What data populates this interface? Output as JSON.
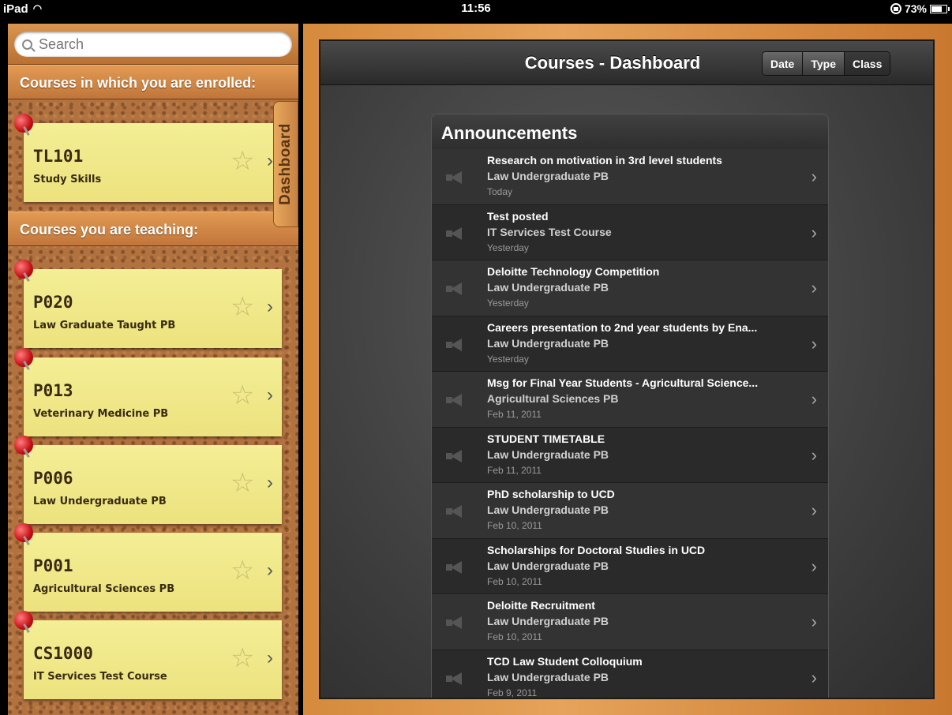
{
  "status": {
    "device": "iPad",
    "time": "11:56",
    "battery_label": "73%",
    "battery_level": 0.73
  },
  "sidebar": {
    "search_placeholder": "Search",
    "enrolled_header": "Courses in which you are enrolled:",
    "teaching_header": "Courses you are teaching:",
    "tab_label": "Dashboard",
    "enrolled": [
      {
        "code": "TL101",
        "title": "Study Skills"
      }
    ],
    "teaching": [
      {
        "code": "P020",
        "title": "Law Graduate Taught PB"
      },
      {
        "code": "P013",
        "title": "Veterinary Medicine PB"
      },
      {
        "code": "P006",
        "title": "Law Undergraduate PB"
      },
      {
        "code": "P001",
        "title": "Agricultural Sciences PB"
      },
      {
        "code": "CS1000",
        "title": "IT Services Test Course"
      }
    ]
  },
  "main": {
    "title": "Courses - Dashboard",
    "sort_options": [
      "Date",
      "Type",
      "Class"
    ],
    "sort_selected": "Class",
    "announcements_title": "Announcements",
    "announcements": [
      {
        "title": "Research on motivation in 3rd level students",
        "course": "Law Undergraduate PB",
        "date": "Today"
      },
      {
        "title": "Test posted",
        "course": "IT Services Test Course",
        "date": "Yesterday"
      },
      {
        "title": "Deloitte Technology Competition",
        "course": "Law Undergraduate PB",
        "date": "Yesterday"
      },
      {
        "title": "Careers presentation to 2nd year students by Ena...",
        "course": "Law Undergraduate PB",
        "date": "Yesterday"
      },
      {
        "title": "Msg for Final Year Students - Agricultural Science...",
        "course": "Agricultural Sciences PB",
        "date": "Feb 11, 2011"
      },
      {
        "title": "STUDENT TIMETABLE",
        "course": "Law Undergraduate PB",
        "date": "Feb 11, 2011"
      },
      {
        "title": "PhD scholarship to UCD",
        "course": "Law Undergraduate PB",
        "date": "Feb 10, 2011"
      },
      {
        "title": "Scholarships for Doctoral Studies in UCD",
        "course": "Law Undergraduate PB",
        "date": "Feb 10, 2011"
      },
      {
        "title": "Deloitte Recruitment",
        "course": "Law Undergraduate PB",
        "date": "Feb 10, 2011"
      },
      {
        "title": "TCD Law Student Colloquium",
        "course": "Law Undergraduate PB",
        "date": "Feb 9, 2011"
      }
    ]
  }
}
